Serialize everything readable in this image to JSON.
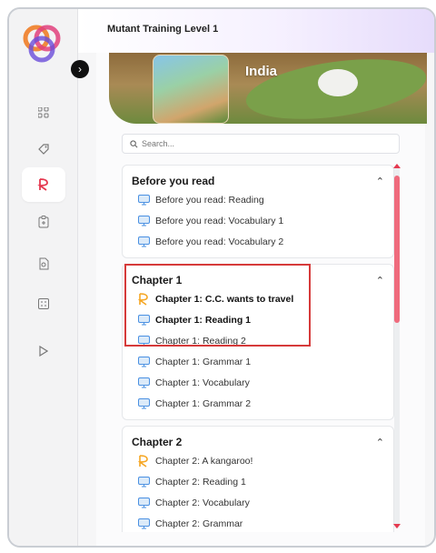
{
  "header": {
    "title": "Mutant Training Level 1"
  },
  "banner": {
    "title": "India"
  },
  "search": {
    "placeholder": "Search..."
  },
  "sidebar": {
    "collapse": "›",
    "icons": [
      "grid-icon",
      "tag-icon",
      "reader-icon",
      "clipboard-icon",
      "document-icon",
      "calculator-icon",
      "play-icon"
    ]
  },
  "sections": [
    {
      "title": "Before you read",
      "items": [
        {
          "label": "Before you read: Reading",
          "icon": "monitor-icon"
        },
        {
          "label": "Before you read: Vocabulary 1",
          "icon": "monitor-icon"
        },
        {
          "label": "Before you read: Vocabulary 2",
          "icon": "monitor-icon"
        }
      ]
    },
    {
      "title": "Chapter 1",
      "items": [
        {
          "label": "Chapter 1: C.C. wants to travel",
          "icon": "reader-icon",
          "bold": true
        },
        {
          "label": "Chapter 1: Reading 1",
          "icon": "monitor-icon",
          "bold": true
        },
        {
          "label": "Chapter 1: Reading 2",
          "icon": "monitor-icon"
        },
        {
          "label": "Chapter 1: Grammar 1",
          "icon": "monitor-icon"
        },
        {
          "label": "Chapter 1: Vocabulary",
          "icon": "monitor-icon"
        },
        {
          "label": "Chapter 1: Grammar 2",
          "icon": "monitor-icon"
        }
      ]
    },
    {
      "title": "Chapter 2",
      "items": [
        {
          "label": "Chapter 2: A kangaroo!",
          "icon": "reader-icon"
        },
        {
          "label": "Chapter 2: Reading 1",
          "icon": "monitor-icon"
        },
        {
          "label": "Chapter 2: Vocabulary",
          "icon": "monitor-icon"
        },
        {
          "label": "Chapter 2: Grammar",
          "icon": "monitor-icon"
        }
      ]
    }
  ],
  "colors": {
    "accent": "#e53950",
    "icon_blue": "#4a90e2",
    "reader_orange": "#f5a623",
    "highlight": "#d63a3a"
  }
}
